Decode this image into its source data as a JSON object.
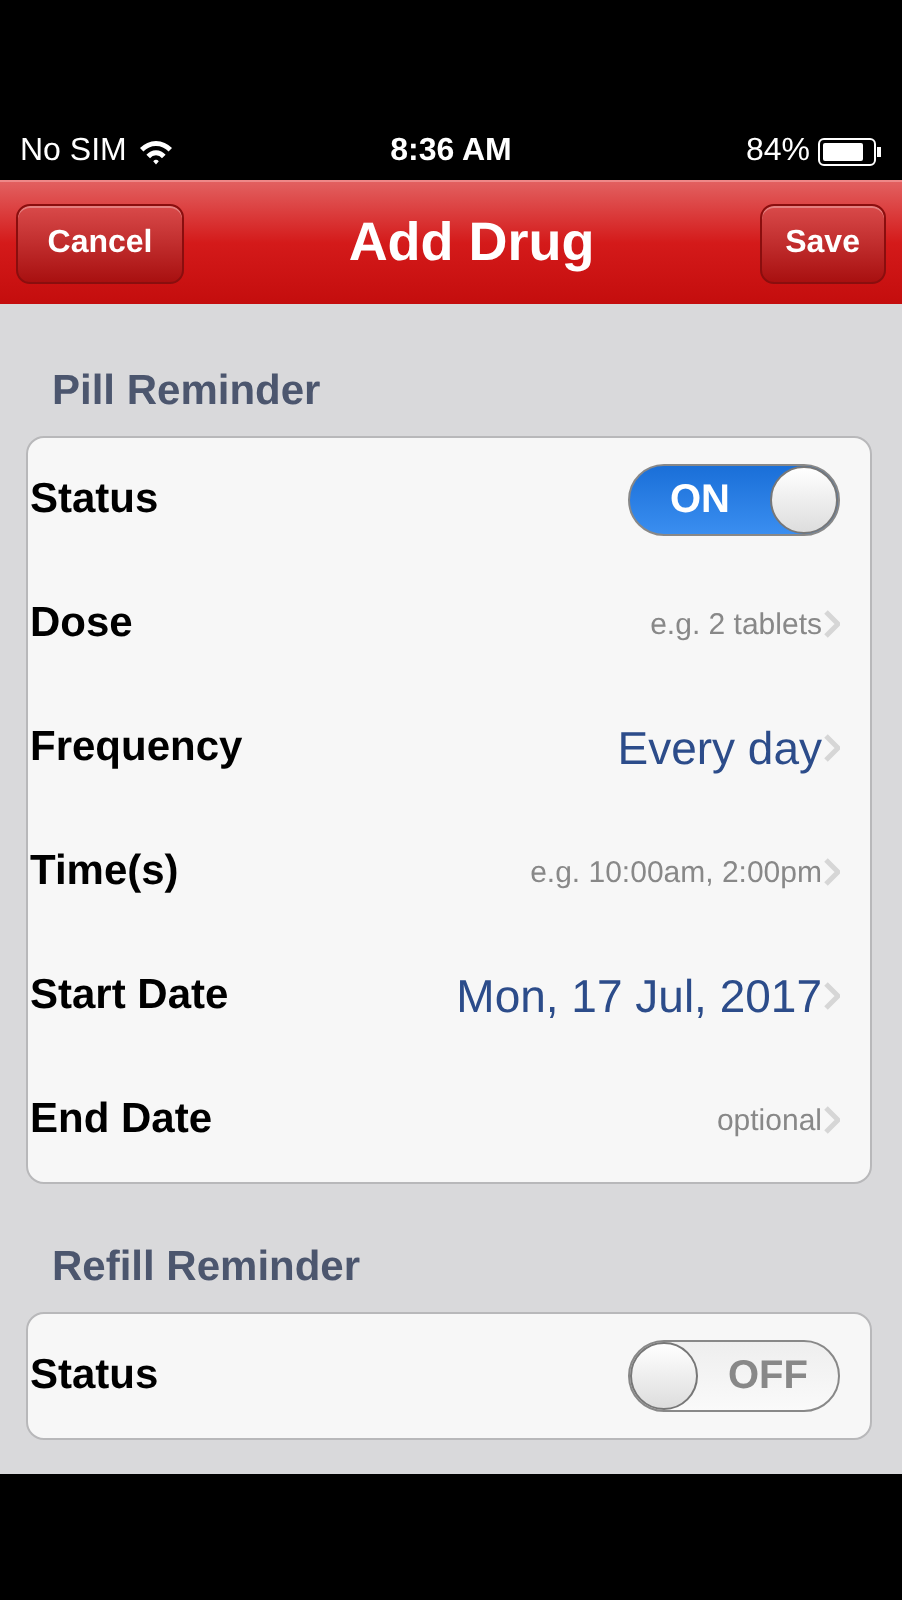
{
  "status_bar": {
    "carrier": "No SIM",
    "time": "8:36 AM",
    "battery": "84%"
  },
  "nav": {
    "left_button": "Cancel",
    "title": "Add Drug",
    "right_button": "Save"
  },
  "sections": [
    {
      "title": "Pill Reminder",
      "rows": [
        {
          "kind": "toggle",
          "label": "Status",
          "on": true,
          "toggle_text": "ON"
        },
        {
          "kind": "placeholder",
          "label": "Dose",
          "value": "e.g. 2 tablets"
        },
        {
          "kind": "value",
          "label": "Frequency",
          "value": "Every day"
        },
        {
          "kind": "placeholder",
          "label": "Time(s)",
          "value": "e.g. 10:00am, 2:00pm"
        },
        {
          "kind": "value",
          "label": "Start Date",
          "value": "Mon, 17 Jul, 2017"
        },
        {
          "kind": "placeholder",
          "label": "End Date",
          "value": "optional"
        }
      ]
    },
    {
      "title": "Refill Reminder",
      "rows": [
        {
          "kind": "toggle",
          "label": "Status",
          "on": false,
          "toggle_text": "OFF"
        }
      ]
    }
  ]
}
